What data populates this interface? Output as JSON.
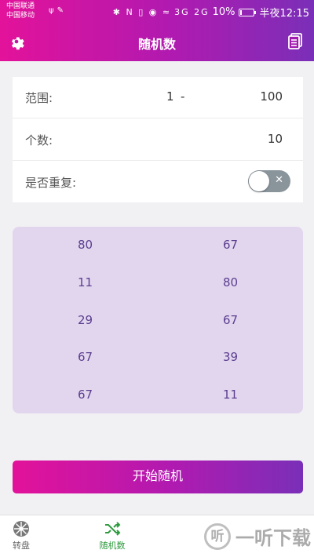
{
  "status_bar": {
    "carrier_1": "中国联通",
    "carrier_2": "中国移动",
    "signal_labels": "3G 2G",
    "battery_text": "10%",
    "battery_level": 0.1,
    "time": "半夜12:15"
  },
  "app_bar": {
    "title": "随机数",
    "left_icon": "gear-icon",
    "right_icon": "document-icon"
  },
  "settings": {
    "range_label": "范围:",
    "range_min": "1",
    "range_separator": "-",
    "range_max": "100",
    "count_label": "个数:",
    "count_value": "10",
    "repeat_label": "是否重复:",
    "repeat_enabled": false,
    "toggle_mark": "✕"
  },
  "results": [
    "80",
    "67",
    "11",
    "80",
    "29",
    "67",
    "67",
    "39",
    "67",
    "11"
  ],
  "start_button_label": "开始随机",
  "tabs": [
    {
      "label": "转盘",
      "icon": "wheel-icon",
      "active": false
    },
    {
      "label": "随机数",
      "icon": "shuffle-icon",
      "active": true
    }
  ],
  "colors": {
    "gradient_start": "#e3129a",
    "gradient_end": "#7a2fb8",
    "results_bg": "#e2d6ef",
    "active_tab": "#2e9a3e"
  },
  "watermark": {
    "logo_char": "听",
    "text": "一听下载"
  }
}
